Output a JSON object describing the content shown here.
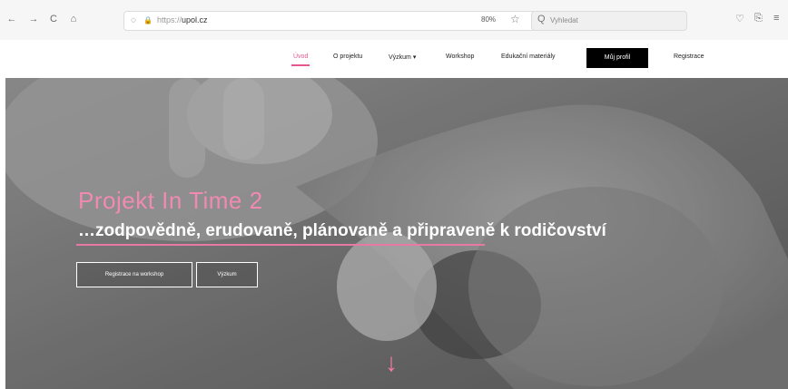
{
  "browser": {
    "back": "←",
    "forward": "→",
    "reload": "C",
    "home": "⌂",
    "shield": "◌",
    "lock": "🔒",
    "url_prefix": "https://",
    "url_host": "upol.cz",
    "zoom": "80%",
    "star": "☆",
    "search_icon": "Q",
    "search_placeholder": "Vyhledat",
    "right_icons": [
      "♡",
      "⎘",
      "≡"
    ]
  },
  "nav": {
    "items": [
      {
        "label": "Úvod",
        "active": true
      },
      {
        "label": "O projektu"
      },
      {
        "label": "Výzkum ▾"
      },
      {
        "label": "Workshop"
      },
      {
        "label": "Edukační materiály"
      }
    ],
    "profile": "Můj profil",
    "register": "Registrace"
  },
  "hero": {
    "title": "Projekt In Time 2",
    "subtitle": "…zodpovědně, erudovaně, plánovaně a připraveně k rodičovství",
    "buttons": [
      "Registrace na workshop",
      "Výzkum"
    ],
    "scroll_arrow": "↓"
  },
  "colors": {
    "accent": "#e8568f",
    "title": "#f08ab1",
    "profile_bg": "#000000"
  }
}
